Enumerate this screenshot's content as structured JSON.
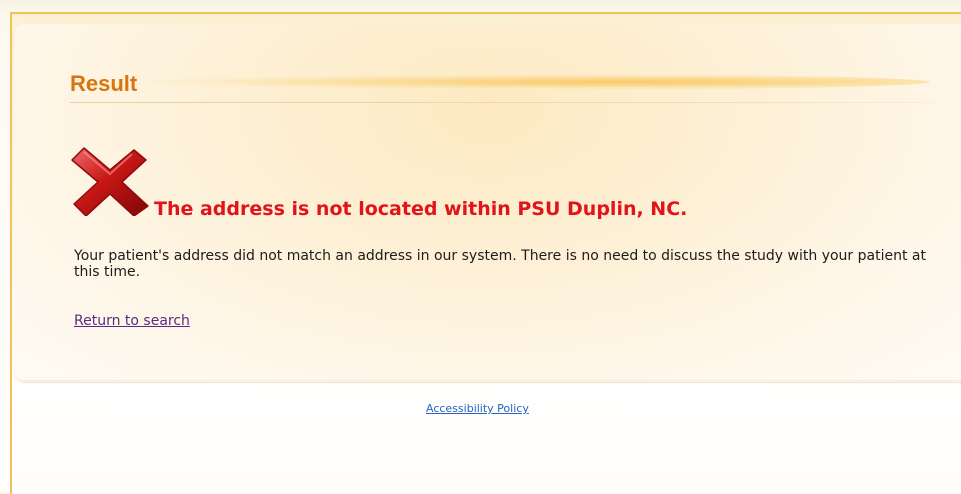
{
  "result": {
    "heading": "Result",
    "error_title": "The address is not located within PSU Duplin, NC.",
    "message": "Your patient's address did not match an address in our system. There is no need to discuss the study with your patient at this time.",
    "return_link": "Return to search"
  },
  "footer": {
    "accessibility_link": "Accessibility Policy"
  },
  "icons": {
    "error": "red-x-icon"
  },
  "colors": {
    "heading": "#d9740f",
    "error_title": "#e0141a",
    "link": "#5b2a86",
    "footer_link": "#2563c4",
    "frame_border": "#f2c25a"
  }
}
